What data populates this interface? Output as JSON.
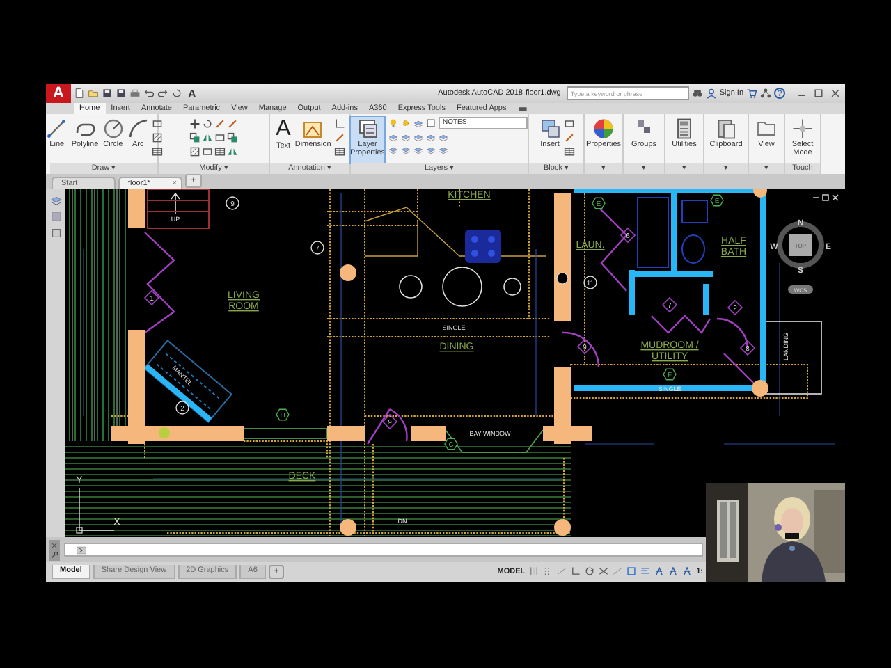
{
  "title_bar": {
    "app_button": "A",
    "quick_access_glyph": "A",
    "title": "Autodesk AutoCAD 2018",
    "file_name": "floor1.dwg",
    "search": {
      "placeholder": "Type a keyword or phrase"
    },
    "sign_in": "Sign In",
    "help": "?"
  },
  "ribbon_tabs": [
    {
      "label": "Home",
      "selected": true
    },
    {
      "label": "Insert",
      "selected": false
    },
    {
      "label": "Annotate",
      "selected": false
    },
    {
      "label": "Parametric",
      "selected": false
    },
    {
      "label": "View",
      "selected": false
    },
    {
      "label": "Manage",
      "selected": false
    },
    {
      "label": "Output",
      "selected": false
    },
    {
      "label": "Add-ins",
      "selected": false
    },
    {
      "label": "A360",
      "selected": false
    },
    {
      "label": "Express Tools",
      "selected": false
    },
    {
      "label": "Featured Apps",
      "selected": false
    }
  ],
  "ribbon_panels": [
    {
      "title": "Draw ▾",
      "tools": [
        {
          "label": "Line",
          "highlighted": false
        },
        {
          "label": "Polyline",
          "highlighted": false
        },
        {
          "label": "Circle",
          "highlighted": false
        },
        {
          "label": "Arc",
          "highlighted": false
        }
      ]
    },
    {
      "title": "Modify ▾"
    },
    {
      "title": "Annotation ▾",
      "tools": [
        {
          "label": "Text",
          "glyph": "A",
          "highlighted": false
        },
        {
          "label": "Dimension",
          "highlighted": false
        }
      ]
    },
    {
      "title": "Layers ▾",
      "tools": [
        {
          "label": "Layer Properties",
          "highlighted": true
        }
      ],
      "layer_dropdown": "NOTES"
    },
    {
      "title": "Block ▾",
      "tools": [
        {
          "label": "Insert",
          "highlighted": false
        }
      ]
    },
    {
      "title": "▾",
      "tools": [
        {
          "label": "Properties",
          "highlighted": false
        }
      ]
    },
    {
      "title": "▾",
      "tools": [
        {
          "label": "Groups",
          "highlighted": false
        }
      ]
    },
    {
      "title": "▾",
      "tools": [
        {
          "label": "Utilities",
          "highlighted": false
        }
      ]
    },
    {
      "title": "▾",
      "tools": [
        {
          "label": "Clipboard",
          "highlighted": false
        }
      ]
    },
    {
      "title": "▾",
      "tools": [
        {
          "label": "View",
          "highlighted": false
        }
      ]
    },
    {
      "title": "Touch",
      "tools": [
        {
          "label": "Select Mode",
          "highlighted": false
        }
      ]
    }
  ],
  "file_tabs": [
    {
      "label": "Start",
      "selected": false
    },
    {
      "label": "floor1*",
      "selected": true,
      "close": "×"
    }
  ],
  "new_tab": "+",
  "drawing": {
    "room_labels": [
      {
        "lines": [
          "KITCHEN"
        ]
      },
      {
        "lines": [
          "LIVING",
          "ROOM"
        ]
      },
      {
        "lines": [
          "DINING"
        ]
      },
      {
        "lines": [
          "LAUN."
        ]
      },
      {
        "lines": [
          "HALF",
          "BATH"
        ]
      },
      {
        "lines": [
          "MUDROOM /",
          "UTILITY"
        ]
      },
      {
        "lines": [
          "DECK"
        ]
      }
    ],
    "notes": [
      "SINGLE",
      "UP",
      "MANTEL",
      "BAY WINDOW",
      "LANDING",
      "DN",
      "SINGLE"
    ],
    "door_tags": [
      {
        "text": "9",
        "kind": "circle"
      },
      {
        "text": "7",
        "kind": "circle"
      },
      {
        "text": "1",
        "kind": "diamond"
      },
      {
        "text": "2",
        "kind": "circle"
      },
      {
        "text": "6",
        "kind": "diamond"
      },
      {
        "text": "7",
        "kind": "diamond"
      },
      {
        "text": "2",
        "kind": "diamond"
      },
      {
        "text": "8",
        "kind": "diamond"
      },
      {
        "text": "9",
        "kind": "diamond"
      },
      {
        "text": "11",
        "kind": "circle"
      },
      {
        "text": "9",
        "kind": "diamond"
      }
    ],
    "window_tags": [
      "E",
      "E",
      "F",
      "H",
      "C"
    ],
    "axis_labels": [
      "Y",
      "X"
    ],
    "viewcube": {
      "north": "N",
      "south": "S",
      "east": "E",
      "west": "W",
      "face": "TOP",
      "ucs": "WCS"
    }
  },
  "layout_tabs": [
    {
      "label": "Model",
      "selected": true
    },
    {
      "label": "Share Design View",
      "selected": false
    },
    {
      "label": "2D Graphics",
      "selected": false
    },
    {
      "label": "A6",
      "selected": false
    }
  ],
  "new_layout": "+",
  "status_bar": {
    "space": "MODEL",
    "scale": "1:"
  }
}
